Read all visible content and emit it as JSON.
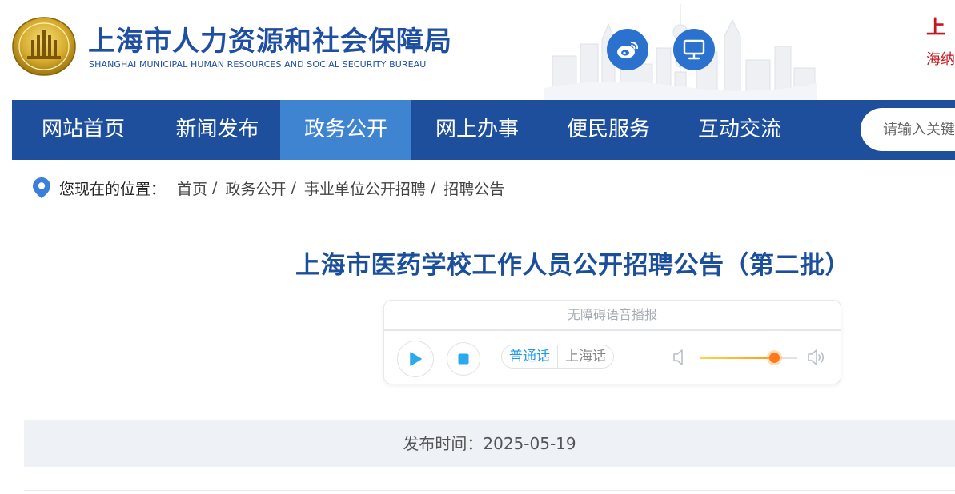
{
  "header": {
    "title": "上海市人力资源和社会保障局",
    "subtitle": "SHANGHAI MUNICIPAL HUMAN RESOURCES AND SOCIAL SECURITY BUREAU",
    "corner_line1": "上",
    "corner_line2": "海纳",
    "icons": [
      "weibo-icon",
      "desktop-icon"
    ]
  },
  "nav": {
    "items": [
      {
        "label": "网站首页"
      },
      {
        "label": "新闻发布"
      },
      {
        "label": "政务公开"
      },
      {
        "label": "网上办事"
      },
      {
        "label": "便民服务"
      },
      {
        "label": "互动交流"
      }
    ],
    "active_item": "政务公开",
    "search_placeholder": "请输入关键"
  },
  "breadcrumb": {
    "label": "您现在的位置：",
    "items": [
      "首页",
      "政务公开",
      "事业单位公开招聘",
      "招聘公告"
    ],
    "separator": "/"
  },
  "article": {
    "title": "上海市医药学校工作人员公开招聘公告（第二批）",
    "publish_label": "发布时间：",
    "publish_date": "2025-05-19",
    "publish_text": "发布时间：2025-05-19"
  },
  "player": {
    "title": "无障碍语音播报",
    "languages": [
      "普通话",
      "上海话"
    ],
    "selected_language": "普通话",
    "volume_fraction": 0.76
  },
  "colors": {
    "brand_blue": "#1d4f9d",
    "nav_active": "#3f84d1",
    "accent_red": "#c9161d",
    "title_blue": "#1b4f9c"
  }
}
